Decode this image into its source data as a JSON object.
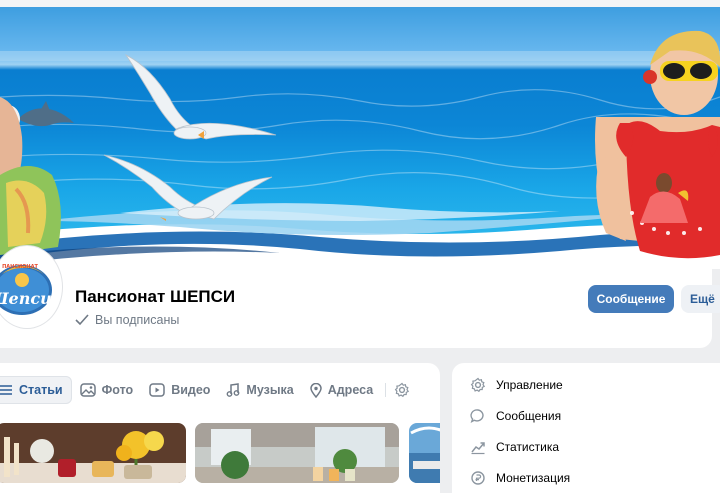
{
  "page": {
    "title": "Пансионат ШЕПСИ",
    "subscription_status": "Вы подписаны",
    "avatar_text": "Шепси",
    "avatar_badge": "ПАНСИОНАТ"
  },
  "actions": {
    "message_button": "Сообщение",
    "more_button": "Ещё"
  },
  "tabs": [
    {
      "label": "Статьи",
      "icon": "list-icon",
      "active": true
    },
    {
      "label": "Фото",
      "icon": "photo-icon",
      "active": false
    },
    {
      "label": "Видео",
      "icon": "video-icon",
      "active": false
    },
    {
      "label": "Музыка",
      "icon": "music-icon",
      "active": false
    },
    {
      "label": "Адреса",
      "icon": "location-pin-icon",
      "active": false
    }
  ],
  "settings_icon": "gear-icon",
  "side_menu": [
    {
      "label": "Управление",
      "icon": "gear-icon"
    },
    {
      "label": "Сообщения",
      "icon": "chat-bubble-icon"
    },
    {
      "label": "Статистика",
      "icon": "trend-chart-icon"
    },
    {
      "label": "Монетизация",
      "icon": "coin-icon"
    }
  ],
  "colors": {
    "accent": "#447bba",
    "link": "#2c5d97",
    "muted_text": "#6f7985",
    "page_background": "#edeef0",
    "sea": "#0c86d6"
  }
}
